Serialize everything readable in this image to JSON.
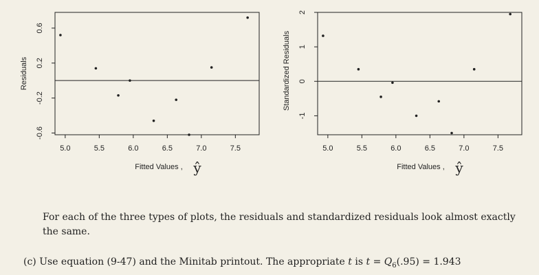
{
  "chart_data": [
    {
      "type": "scatter",
      "ylabel": "Residuals",
      "xlabel_text": "Fitted Values ,",
      "xlabel_handwritten": "ŷ",
      "xticks": [
        "5.0",
        "5.5",
        "6.0",
        "6.5",
        "7.0",
        "7.5"
      ],
      "yticks": [
        "-0.6",
        "-0.2",
        "0.2",
        "0.6"
      ],
      "xlim": [
        4.85,
        7.85
      ],
      "ylim": [
        -0.62,
        0.78
      ],
      "reference_line_y": 0,
      "x": [
        4.93,
        5.45,
        5.78,
        5.95,
        6.3,
        6.63,
        6.82,
        7.15,
        7.68
      ],
      "y": [
        0.52,
        0.14,
        -0.17,
        0.0,
        -0.46,
        -0.22,
        -0.62,
        0.15,
        0.72
      ]
    },
    {
      "type": "scatter",
      "ylabel": "Standardized Residuals",
      "xlabel_text": "Fitted Values ,",
      "xlabel_handwritten": "ŷ",
      "xticks": [
        "5.0",
        "5.5",
        "6.0",
        "6.5",
        "7.0",
        "7.5"
      ],
      "yticks": [
        "-1",
        "0",
        "1",
        "2"
      ],
      "xlim": [
        4.85,
        7.85
      ],
      "ylim": [
        -1.55,
        2.0
      ],
      "reference_line_y": 0,
      "x": [
        4.93,
        5.45,
        5.78,
        5.95,
        6.3,
        6.63,
        6.82,
        7.15,
        7.68
      ],
      "y": [
        1.32,
        0.35,
        -0.45,
        -0.04,
        -1.0,
        -0.58,
        -1.5,
        0.35,
        1.95
      ]
    }
  ],
  "text": {
    "p1": "For each of the three types of plots, the residuals and standardized residuals look almost exactly the same.",
    "p2_prefix": "(c)  Use equation (9-47) and the Minitab printout. The appropriate ",
    "p2_t": "t",
    "p2_is": " is ",
    "p2_t2": "t",
    "p2_eq": " = ",
    "p2_Q": "Q",
    "p2_sub": "6",
    "p2_rest": "(.95) = 1.943"
  }
}
